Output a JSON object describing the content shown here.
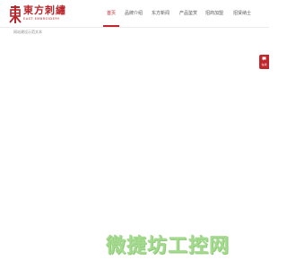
{
  "brand": {
    "name_cn": "東方刺繡",
    "name_en": "EAST EMBROIDERY",
    "accent_color": "#c0272d",
    "logo_icon": "dongfang-emblem-icon"
  },
  "nav": {
    "items": [
      {
        "label": "首页",
        "active": true
      },
      {
        "label": "品牌介绍",
        "active": false
      },
      {
        "label": "东方新闻",
        "active": false
      },
      {
        "label": "产品鉴赏",
        "active": false
      },
      {
        "label": "招商加盟",
        "active": false
      },
      {
        "label": "招贤纳士",
        "active": false
      }
    ]
  },
  "breadcrumb": {
    "text": "网站建设示范文本"
  },
  "side_tab": {
    "label": "在线",
    "icon": "chat-bubble-icon"
  },
  "watermark": {
    "text": "微捷坊工控网",
    "color": "#a5d98f"
  }
}
